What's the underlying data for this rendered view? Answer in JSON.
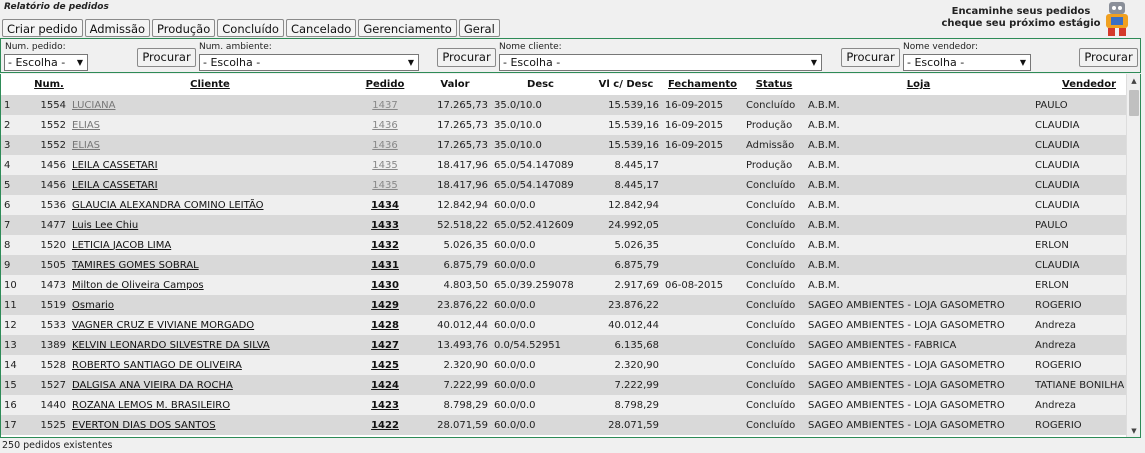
{
  "page": {
    "title": "Relatório de pedidos",
    "footer": "250 pedidos existentes"
  },
  "tabs": [
    "Criar pedido",
    "Admissão",
    "Produção",
    "Concluído",
    "Cancelado",
    "Gerenciamento",
    "Geral"
  ],
  "promo": {
    "line1": "Encaminhe seus pedidos",
    "line2": "cheque seu próximo estágio"
  },
  "filters": {
    "num_pedido": {
      "label": "Num. pedido:",
      "value": "- Escolha -"
    },
    "num_ambiente": {
      "label": "Num. ambiente:",
      "value": "- Escolha -"
    },
    "nome_cliente": {
      "label": "Nome cliente:",
      "value": "- Escolha -"
    },
    "nome_vendedor": {
      "label": "Nome vendedor:",
      "value": "- Escolha -"
    },
    "search_label": "Procurar"
  },
  "table": {
    "headers": [
      "Num.",
      "Cliente",
      "Pedido",
      "Valor",
      "Desc",
      "Vl c/ Desc",
      "Fechamento",
      "Status",
      "Loja",
      "Vendedor"
    ],
    "rows": [
      {
        "idx": "1",
        "num": "1554",
        "cliente": "LUCIANA",
        "pedido": "1437",
        "valor": "17.265,73",
        "desc": "35.0/10.0",
        "vlc": "15.539,16",
        "fech": "16-09-2015",
        "status": "Concluído",
        "loja": "A.B.M.",
        "vend": "PAULO",
        "muted": true
      },
      {
        "idx": "2",
        "num": "1552",
        "cliente": "ELIAS",
        "pedido": "1436",
        "valor": "17.265,73",
        "desc": "35.0/10.0",
        "vlc": "15.539,16",
        "fech": "16-09-2015",
        "status": "Produção",
        "loja": "A.B.M.",
        "vend": "CLAUDIA",
        "muted": true
      },
      {
        "idx": "3",
        "num": "1552",
        "cliente": "ELIAS",
        "pedido": "1436",
        "valor": "17.265,73",
        "desc": "35.0/10.0",
        "vlc": "15.539,16",
        "fech": "16-09-2015",
        "status": "Admissão",
        "loja": "A.B.M.",
        "vend": "CLAUDIA",
        "muted": true
      },
      {
        "idx": "4",
        "num": "1456",
        "cliente": "LEILA CASSETARI",
        "pedido": "1435",
        "valor": "18.417,96",
        "desc": "65.0/54.147089",
        "vlc": "8.445,17",
        "fech": "",
        "status": "Produção",
        "loja": "A.B.M.",
        "vend": "CLAUDIA",
        "muted": false,
        "pmuted": true
      },
      {
        "idx": "5",
        "num": "1456",
        "cliente": "LEILA CASSETARI",
        "pedido": "1435",
        "valor": "18.417,96",
        "desc": "65.0/54.147089",
        "vlc": "8.445,17",
        "fech": "",
        "status": "Concluído",
        "loja": "A.B.M.",
        "vend": "CLAUDIA",
        "muted": false,
        "pmuted": true
      },
      {
        "idx": "6",
        "num": "1536",
        "cliente": "GLAUCIA ALEXANDRA COMINO LEITÃO",
        "pedido": "1434",
        "valor": "12.842,94",
        "desc": "60.0/0.0",
        "vlc": "12.842,94",
        "fech": "",
        "status": "Concluído",
        "loja": "A.B.M.",
        "vend": "CLAUDIA"
      },
      {
        "idx": "7",
        "num": "1477",
        "cliente": "Luis Lee Chiu",
        "pedido": "1433",
        "valor": "52.518,22",
        "desc": "65.0/52.412609",
        "vlc": "24.992,05",
        "fech": "",
        "status": "Concluído",
        "loja": "A.B.M.",
        "vend": "PAULO"
      },
      {
        "idx": "8",
        "num": "1520",
        "cliente": "LETICIA JACOB LIMA",
        "pedido": "1432",
        "valor": "5.026,35",
        "desc": "60.0/0.0",
        "vlc": "5.026,35",
        "fech": "",
        "status": "Concluído",
        "loja": "A.B.M.",
        "vend": "ERLON"
      },
      {
        "idx": "9",
        "num": "1505",
        "cliente": "TAMIRES GOMES SOBRAL",
        "pedido": "1431",
        "valor": "6.875,79",
        "desc": "60.0/0.0",
        "vlc": "6.875,79",
        "fech": "",
        "status": "Concluído",
        "loja": "A.B.M.",
        "vend": "CLAUDIA"
      },
      {
        "idx": "10",
        "num": "1473",
        "cliente": "Milton de Oliveira Campos",
        "pedido": "1430",
        "valor": "4.803,50",
        "desc": "65.0/39.259078",
        "vlc": "2.917,69",
        "fech": "06-08-2015",
        "status": "Concluído",
        "loja": "A.B.M.",
        "vend": "ERLON"
      },
      {
        "idx": "11",
        "num": "1519",
        "cliente": "Osmario",
        "pedido": "1429",
        "valor": "23.876,22",
        "desc": "60.0/0.0",
        "vlc": "23.876,22",
        "fech": "",
        "status": "Concluído",
        "loja": "SAGEO AMBIENTES - LOJA GASOMETRO",
        "vend": "ROGERIO"
      },
      {
        "idx": "12",
        "num": "1533",
        "cliente": "VAGNER CRUZ E VIVIANE MORGADO",
        "pedido": "1428",
        "valor": "40.012,44",
        "desc": "60.0/0.0",
        "vlc": "40.012,44",
        "fech": "",
        "status": "Concluído",
        "loja": "SAGEO AMBIENTES - LOJA GASOMETRO",
        "vend": "Andreza"
      },
      {
        "idx": "13",
        "num": "1389",
        "cliente": "KELVIN LEONARDO SILVESTRE DA SILVA",
        "pedido": "1427",
        "valor": "13.493,76",
        "desc": "0.0/54.52951",
        "vlc": "6.135,68",
        "fech": "",
        "status": "Concluído",
        "loja": "SAGEO AMBIENTES - FABRICA",
        "vend": "Andreza"
      },
      {
        "idx": "14",
        "num": "1528",
        "cliente": "ROBERTO SANTIAGO DE OLIVEIRA",
        "pedido": "1425",
        "valor": "2.320,90",
        "desc": "60.0/0.0",
        "vlc": "2.320,90",
        "fech": "",
        "status": "Concluído",
        "loja": "SAGEO AMBIENTES - LOJA GASOMETRO",
        "vend": "ROGERIO"
      },
      {
        "idx": "15",
        "num": "1527",
        "cliente": "DALGISA ANA VIEIRA DA ROCHA",
        "pedido": "1424",
        "valor": "7.222,99",
        "desc": "60.0/0.0",
        "vlc": "7.222,99",
        "fech": "",
        "status": "Concluído",
        "loja": "SAGEO AMBIENTES - LOJA GASOMETRO",
        "vend": "TATIANE BONILHA"
      },
      {
        "idx": "16",
        "num": "1440",
        "cliente": "ROZANA LEMOS M. BRASILEIRO",
        "pedido": "1423",
        "valor": "8.798,29",
        "desc": "60.0/0.0",
        "vlc": "8.798,29",
        "fech": "",
        "status": "Concluído",
        "loja": "SAGEO AMBIENTES - LOJA GASOMETRO",
        "vend": "Andreza"
      },
      {
        "idx": "17",
        "num": "1525",
        "cliente": "EVERTON DIAS DOS SANTOS",
        "pedido": "1422",
        "valor": "28.071,59",
        "desc": "60.0/0.0",
        "vlc": "28.071,59",
        "fech": "",
        "status": "Concluído",
        "loja": "SAGEO AMBIENTES - LOJA GASOMETRO",
        "vend": "ROGERIO"
      }
    ]
  }
}
